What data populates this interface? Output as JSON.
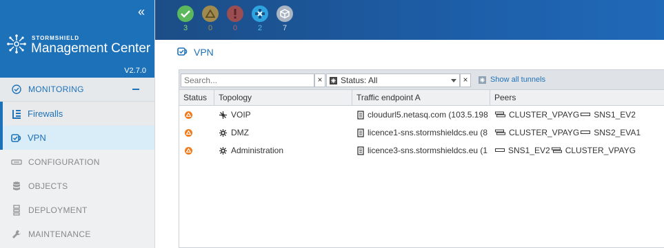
{
  "sidebar": {
    "brand_small": "STORMSHIELD",
    "brand_name": "Management Center",
    "version": "V2.7.0",
    "collapse_glyph": "«",
    "items": [
      {
        "label": "MONITORING",
        "icon": "check-circle-icon"
      },
      {
        "label": "Firewalls",
        "icon": "firewall-list-icon"
      },
      {
        "label": "VPN",
        "icon": "vpn-icon"
      },
      {
        "label": "CONFIGURATION",
        "icon": "config-icon"
      },
      {
        "label": "OBJECTS",
        "icon": "database-icon"
      },
      {
        "label": "DEPLOYMENT",
        "icon": "deployment-icon"
      },
      {
        "label": "MAINTENANCE",
        "icon": "wrench-icon"
      }
    ]
  },
  "header": {
    "statuses": [
      {
        "name": "ok",
        "count": "3",
        "color": "#5cb85c",
        "count_color": "#8fd36f"
      },
      {
        "name": "warning",
        "count": "0",
        "color": "#a08a4e",
        "count_color": "#a08a4e"
      },
      {
        "name": "error",
        "count": "0",
        "color": "#9a4e52",
        "count_color": "#b85c60"
      },
      {
        "name": "disconnected",
        "count": "2",
        "color": "#2ea3df",
        "count_color": "#55c0f0"
      },
      {
        "name": "unknown",
        "count": "7",
        "color": "#a9b5c2",
        "count_color": "#d6dde4"
      }
    ]
  },
  "page": {
    "title": "VPN"
  },
  "toolbar": {
    "search_placeholder": "Search...",
    "clear_glyph": "×",
    "status_filter": "Status: All",
    "show_all_tunnels": "Show all tunnels"
  },
  "table": {
    "columns": [
      "Status",
      "Topology",
      "Traffic endpoint A",
      "Peers"
    ],
    "rows": [
      {
        "status": "warning",
        "topology": "VOIP",
        "topology_icon": "hub-icon",
        "endpoint": "cloudurl5.netasq.com (103.5.198",
        "peers": [
          "CLUSTER_VPAYG",
          "SNS1_EV2"
        ]
      },
      {
        "status": "warning",
        "topology": "DMZ",
        "topology_icon": "mesh-icon",
        "endpoint": "licence1-sns.stormshieldcs.eu (8",
        "peers": [
          "CLUSTER_VPAYG",
          "SNS2_EVA1"
        ]
      },
      {
        "status": "warning",
        "topology": "Administration",
        "topology_icon": "mesh-icon",
        "endpoint": "licence3-sns.stormshieldcs.eu (1",
        "peers": [
          "SNS1_EV2",
          "CLUSTER_VPAYG"
        ]
      }
    ]
  }
}
